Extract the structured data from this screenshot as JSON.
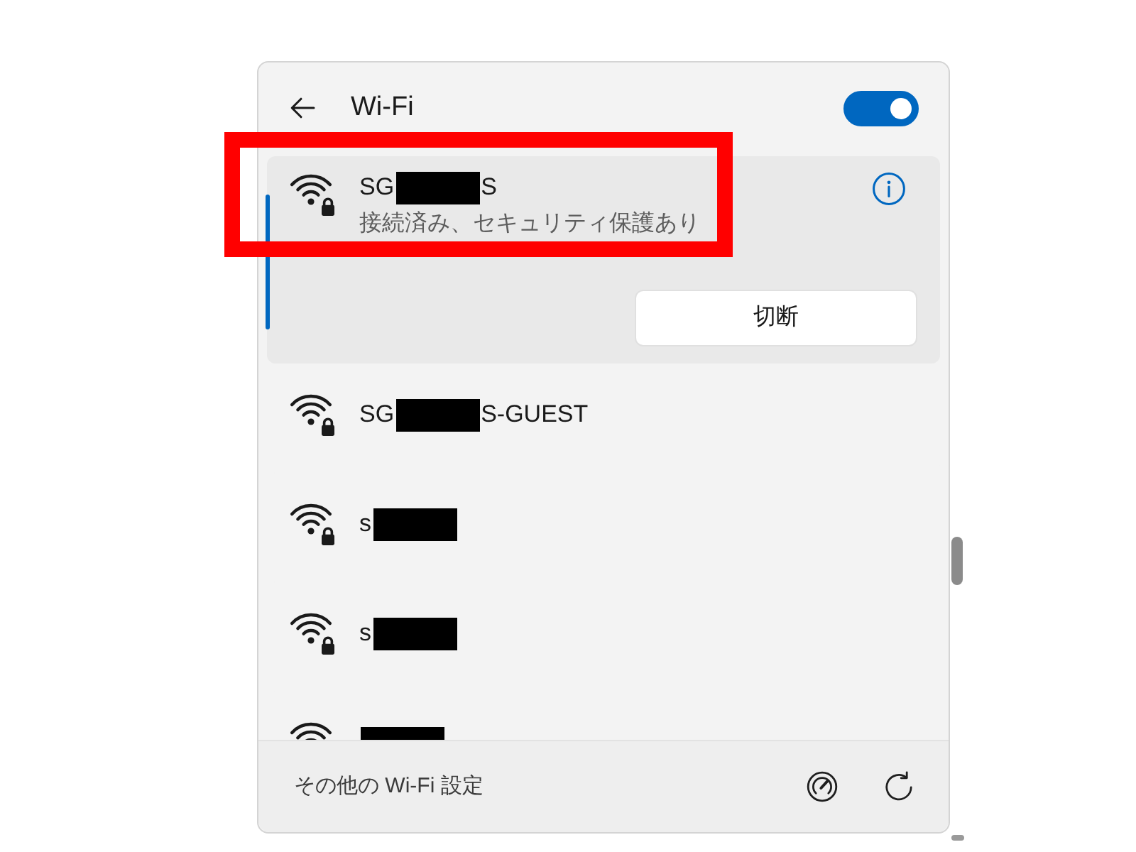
{
  "header": {
    "title": "Wi-Fi",
    "toggle": {
      "on": true
    }
  },
  "networks": [
    {
      "name": [
        {
          "kind": "text",
          "text": "SG"
        },
        {
          "kind": "redaction"
        },
        {
          "kind": "text",
          "text": "S"
        }
      ],
      "secured": true,
      "selected": true,
      "status": "接続済み、セキュリティ保護あり",
      "action": "切断"
    },
    {
      "name": [
        {
          "kind": "text",
          "text": "SG"
        },
        {
          "kind": "redaction"
        },
        {
          "kind": "text",
          "text": "S-GUEST"
        }
      ],
      "secured": true,
      "selected": false
    },
    {
      "name": [
        {
          "kind": "text",
          "text": "s"
        },
        {
          "kind": "redaction"
        }
      ],
      "secured": true,
      "selected": false
    },
    {
      "name": [
        {
          "kind": "text",
          "text": "s"
        },
        {
          "kind": "redaction"
        }
      ],
      "secured": true,
      "selected": false
    },
    {
      "name": [
        {
          "kind": "redaction"
        }
      ],
      "selected": false
    }
  ],
  "footer": {
    "link": "その他の Wi-Fi 設定"
  }
}
